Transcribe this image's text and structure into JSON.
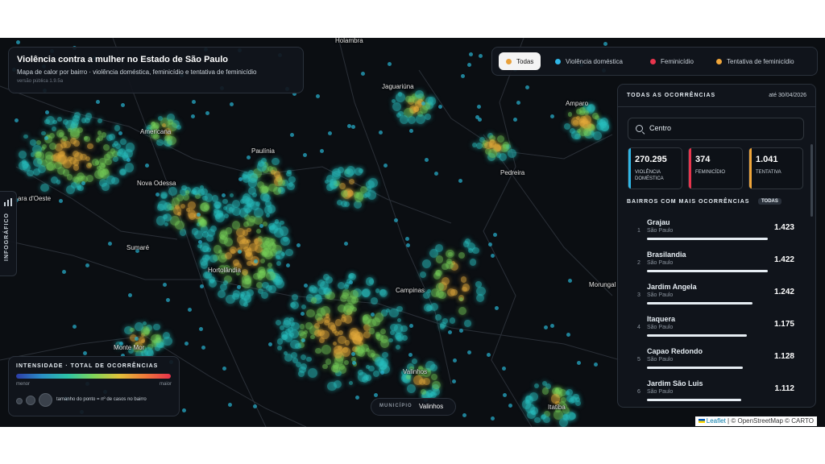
{
  "header": {
    "title": "Violência contra a mulher no Estado de São Paulo",
    "subtitle": "Mapa de calor por bairro · violência doméstica, feminicídio e tentativa de feminicídio",
    "version": "versão pública 1.9.5a"
  },
  "filters": [
    {
      "label": "Todas",
      "color": "#e9a13b",
      "active": true
    },
    {
      "label": "Violência doméstica",
      "color": "#2fb6e6",
      "active": false
    },
    {
      "label": "Feminicídio",
      "color": "#e8354d",
      "active": false
    },
    {
      "label": "Tentativa de feminicídio",
      "color": "#f0a63a",
      "active": false
    }
  ],
  "side_tab": {
    "label": "INFOGRÁFICO"
  },
  "map_places": {
    "holambra": "Holambra",
    "jaguariuna": "Jaguariúna",
    "amparo": "Amparo",
    "americana": "Americana",
    "paulinia": "Paulínia",
    "pedreira": "Pedreira",
    "nova_odessa": "Nova Odessa",
    "santa_barbara": "ara d'Oeste",
    "sumare": "Sumaré",
    "hortolandia": "Hortolândia",
    "campinas": "Campinas",
    "morungaba": "Morungal",
    "monte_mor": "Monte Mor",
    "valinhos": "Valinhos",
    "itatiba": "Itatiba"
  },
  "legend": {
    "title": "INTENSIDADE · TOTAL DE OCORRÊNCIAS",
    "min_label": "menor",
    "max_label": "maior",
    "size_note": "tamanho do ponto = nº de casos no bairro"
  },
  "municipio": {
    "key": "MUNICÍPIO",
    "value": "Valinhos"
  },
  "panel": {
    "title": "TODAS AS OCORRÊNCIAS",
    "date": "até 30/04/2026",
    "search_value": "Centro",
    "cards": [
      {
        "value": "270.295",
        "label": "VIOLÊNCIA DOMÉSTICA",
        "color": "#2fb6e6"
      },
      {
        "value": "374",
        "label": "FEMINICÍDIO",
        "color": "#e8354d"
      },
      {
        "value": "1.041",
        "label": "TENTATIVA",
        "color": "#f0a63a"
      }
    ],
    "ranking_title": "BAIRROS COM MAIS OCORRÊNCIAS",
    "ranking_tag": "TODAS",
    "ranking": [
      {
        "rank": "1",
        "name": "Grajau",
        "city": "São Paulo",
        "count": "1.423",
        "share": 1.0
      },
      {
        "rank": "2",
        "name": "Brasilandia",
        "city": "São Paulo",
        "count": "1.422",
        "share": 0.999
      },
      {
        "rank": "3",
        "name": "Jardim Angela",
        "city": "São Paulo",
        "count": "1.242",
        "share": 0.873
      },
      {
        "rank": "4",
        "name": "Itaquera",
        "city": "São Paulo",
        "count": "1.175",
        "share": 0.826
      },
      {
        "rank": "5",
        "name": "Capao Redondo",
        "city": "São Paulo",
        "count": "1.128",
        "share": 0.793
      },
      {
        "rank": "6",
        "name": "Jardim São Luis",
        "city": "São Paulo",
        "count": "1.112",
        "share": 0.781
      }
    ]
  },
  "attribution": {
    "leaflet": "Leaflet",
    "rest": "| © OpenStreetMap © CARTO"
  }
}
